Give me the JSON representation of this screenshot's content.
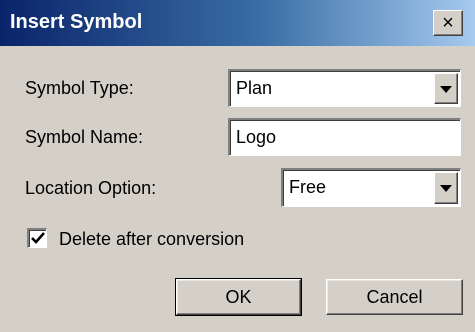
{
  "window": {
    "title": "Insert Symbol",
    "close_glyph": "×",
    "close_icon": "close-icon",
    "background": "#d4d0c8",
    "titlebar_colors": [
      "#0a246a",
      "#a6caf0"
    ]
  },
  "form": {
    "symbol_type": {
      "label": "Symbol Type:",
      "value": "Plan"
    },
    "symbol_name": {
      "label": "Symbol Name:",
      "value": "Logo"
    },
    "location_option": {
      "label": "Location Option:",
      "value": "Free"
    },
    "delete_after_conversion": {
      "label": "Delete after conversion",
      "checked": true
    }
  },
  "buttons": {
    "ok": "OK",
    "cancel": "Cancel"
  }
}
